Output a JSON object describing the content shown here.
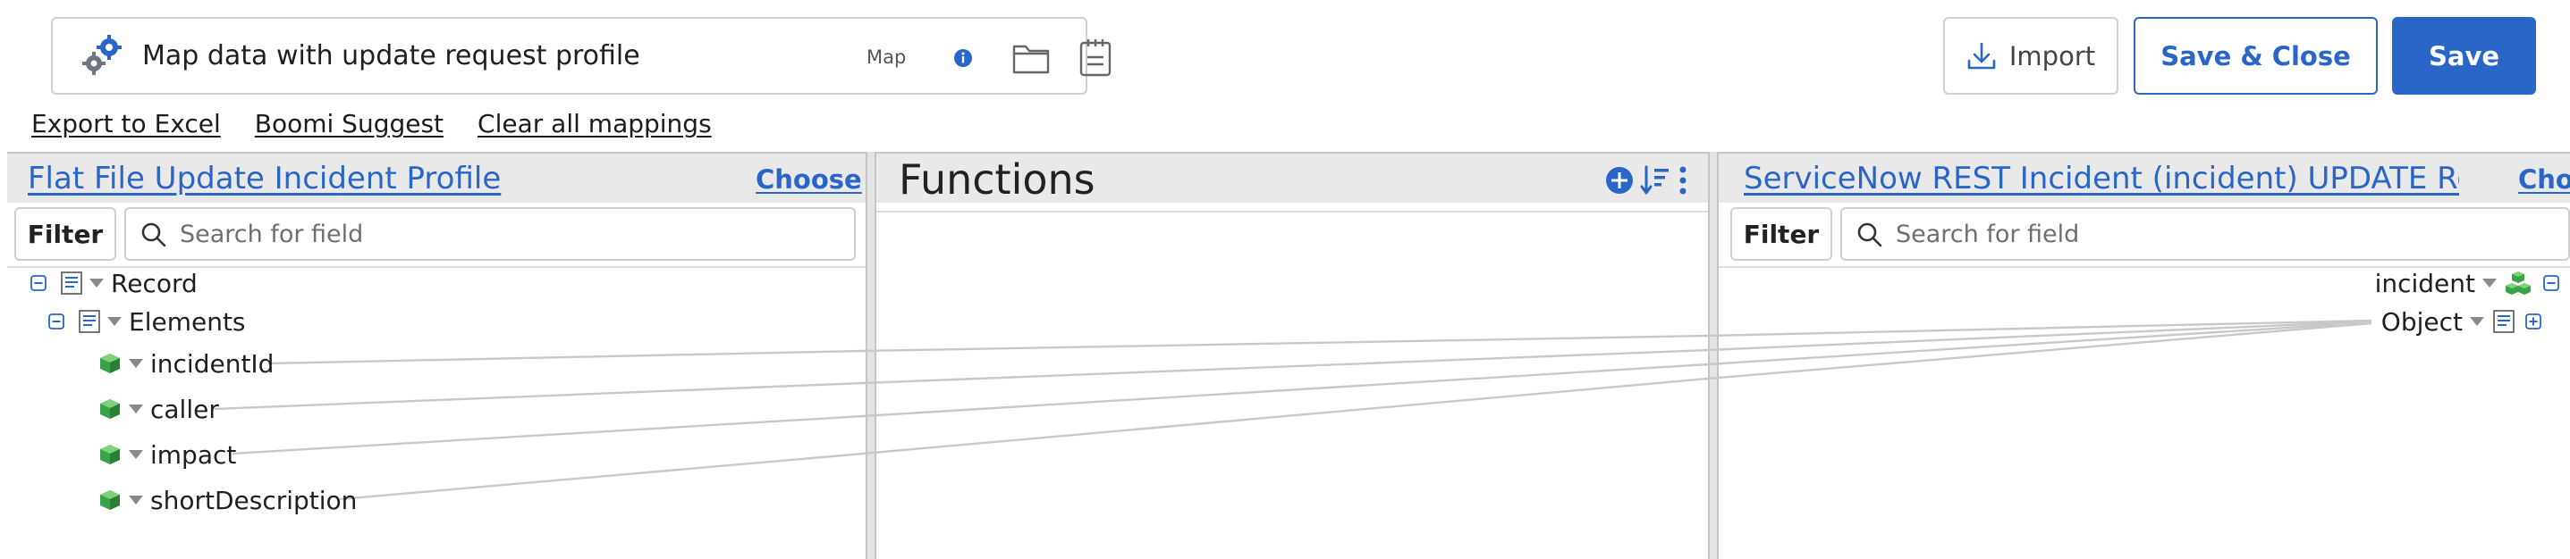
{
  "header": {
    "title": "Map data with update request profile",
    "type_label": "Map",
    "icons": [
      "gear-pair-icon",
      "info-icon",
      "folder-icon",
      "notes-icon"
    ]
  },
  "actions": {
    "import_label": "Import",
    "save_close_label": "Save & Close",
    "save_label": "Save"
  },
  "links": {
    "export": "Export to Excel",
    "suggest": "Boomi Suggest",
    "clear": "Clear all mappings"
  },
  "source": {
    "profile_name": "Flat File Update Incident Profile",
    "choose_label": "Choose",
    "filter_label": "Filter",
    "search_placeholder": "Search for field",
    "tree": {
      "record": "Record",
      "elements": "Elements",
      "fields": [
        "incidentId",
        "caller",
        "impact",
        "shortDescription"
      ]
    }
  },
  "functions": {
    "title": "Functions",
    "icons": [
      "add-circle-icon",
      "sort-icon",
      "more-vertical-icon"
    ]
  },
  "destination": {
    "profile_name": "ServiceNow REST Incident (incident) UPDATE Req...",
    "choose_label": "Choose",
    "filter_label": "Filter",
    "search_placeholder": "Search for field",
    "tree": {
      "root": "incident",
      "object": "Object"
    }
  },
  "colors": {
    "accent": "#2a66c8",
    "panel_header": "#e9e9e9",
    "field_icon": "#3aa34a",
    "connector_line": "#c8c8c8"
  }
}
